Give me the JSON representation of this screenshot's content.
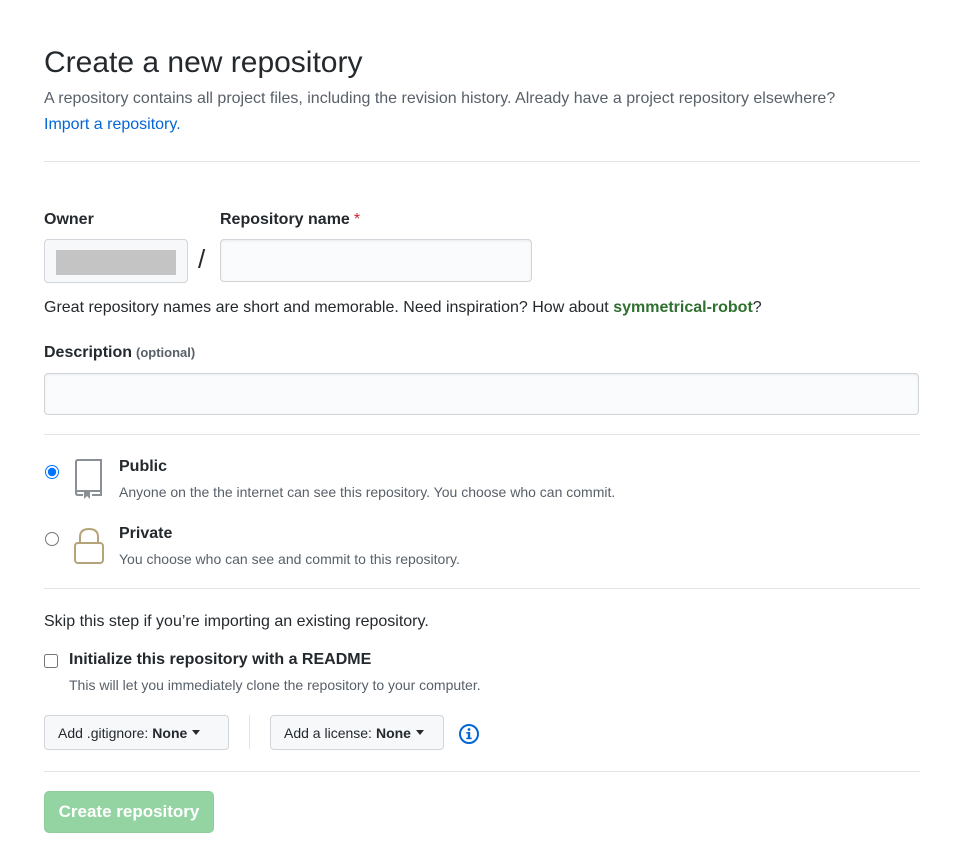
{
  "header": {
    "title": "Create a new repository",
    "subtitle": "A repository contains all project files, including the revision history. Already have a project repository elsewhere?",
    "import_link": "Import a repository."
  },
  "form": {
    "owner_label": "Owner",
    "owner_value": "",
    "separator": "/",
    "repo_name_label": "Repository name",
    "required_marker": "*",
    "repo_name_value": "",
    "hint_prefix": "Great repository names are short and memorable. Need inspiration? How about ",
    "hint_suggestion": "symmetrical-robot",
    "hint_suffix": "?",
    "description_label": "Description",
    "description_optional": "(optional)",
    "description_value": ""
  },
  "visibility": {
    "selected": "public",
    "public": {
      "title": "Public",
      "description": "Anyone on the the internet can see this repository. You choose who can commit.",
      "icon": "repo-book-icon"
    },
    "private": {
      "title": "Private",
      "description": "You choose who can see and commit to this repository.",
      "icon": "lock-icon"
    }
  },
  "init": {
    "skip_text": "Skip this step if you’re importing an existing repository.",
    "readme_label": "Initialize this repository with a README",
    "readme_checked": false,
    "readme_desc": "This will let you immediately clone the repository to your computer.",
    "gitignore_prefix": "Add .gitignore:",
    "gitignore_value": "None",
    "license_prefix": "Add a license:",
    "license_value": "None",
    "info_icon": "info-icon"
  },
  "submit": {
    "label": "Create repository"
  },
  "colors": {
    "link": "#0366d6",
    "required": "#cb2431",
    "suggestion": "#2f6f2f",
    "submit_disabled_bg": "#94d3a2",
    "lock_icon": "#b5a47a"
  }
}
